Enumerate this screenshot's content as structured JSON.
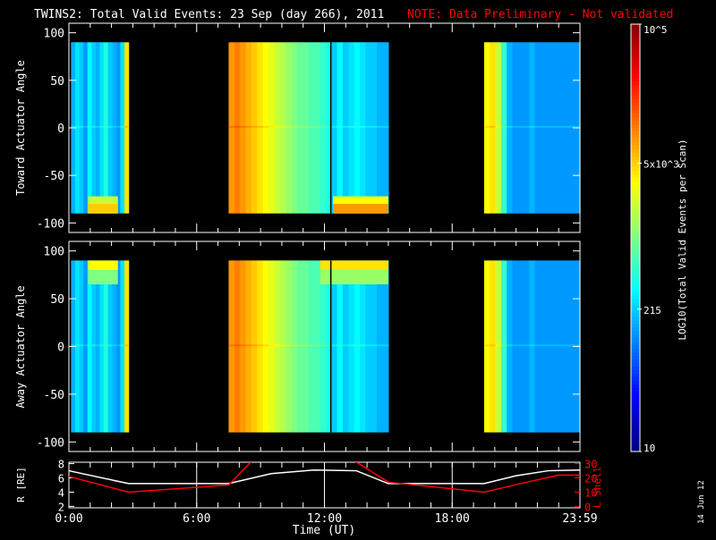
{
  "title": {
    "main": "TWINS2: Total Valid Events: 23 Sep (day 266), 2011",
    "note": "NOTE: Data Preliminary - Not validated"
  },
  "stamp": "14 Jun 12",
  "colors": {
    "note": "#ff0000",
    "r_line": "#ffffff",
    "l_line": "#ff0000"
  },
  "chart_data": [
    {
      "type": "heatmap",
      "name": "toward",
      "ylabel": "Toward Actuator Angle",
      "ylim": [
        -110,
        110
      ],
      "yticks": [
        100,
        50,
        0,
        -50,
        -100
      ],
      "ytick_labels": [
        "100",
        "50",
        "0",
        "-50",
        "-100"
      ],
      "data_yrange": [
        -90,
        90
      ],
      "xlim_hours": [
        0,
        24
      ],
      "blocks": [
        {
          "start": 0.1,
          "end": 2.8,
          "cols": [
            2.2,
            2.4,
            2.3,
            2.1,
            2.5,
            2.3,
            2.2,
            2.4,
            2.6,
            2.3,
            2.2,
            2.1,
            2.4,
            3.6
          ],
          "low_enh": [
            [
              0.9,
              2.3,
              3.7
            ]
          ]
        },
        {
          "start": 7.5,
          "end": 15.0,
          "cols": [
            3.9,
            4.0,
            3.9,
            3.8,
            3.7,
            3.6,
            3.5,
            3.4,
            3.3,
            3.2,
            3.1,
            3.0,
            2.9,
            2.9,
            2.8,
            2.8,
            2.7,
            2.6,
            2.3,
            2.5,
            2.3,
            2.4,
            2.5,
            2.4,
            2.3,
            2.3,
            2.2,
            2.2
          ],
          "low_enh": [
            [
              12.4,
              15.0,
              3.9
            ]
          ]
        },
        {
          "start": 19.5,
          "end": 24.0,
          "cols": [
            3.5,
            3.6,
            3.3,
            2.7,
            2.2,
            2.1,
            2.1,
            2.1,
            2.2,
            2.1,
            2.1,
            2.1,
            2.1,
            2.1,
            2.1,
            2.1,
            2.1
          ],
          "low_enh": []
        }
      ],
      "marker_hour": 12.3
    },
    {
      "type": "heatmap",
      "name": "away",
      "ylabel": "Away Actuator Angle",
      "ylim": [
        -110,
        110
      ],
      "yticks": [
        100,
        50,
        0,
        -50,
        -100
      ],
      "ytick_labels": [
        "100",
        "50",
        "0",
        "-50",
        "-100"
      ],
      "data_yrange": [
        -90,
        90
      ],
      "xlim_hours": [
        0,
        24
      ],
      "blocks": [
        {
          "start": 0.1,
          "end": 2.8,
          "cols": [
            2.2,
            2.4,
            2.3,
            2.1,
            2.5,
            2.3,
            2.2,
            2.4,
            2.6,
            2.3,
            2.2,
            2.1,
            2.4,
            3.6
          ],
          "high_enh": [
            [
              0.9,
              2.3,
              3.5
            ]
          ]
        },
        {
          "start": 7.5,
          "end": 15.0,
          "cols": [
            3.9,
            4.0,
            3.9,
            3.8,
            3.7,
            3.6,
            3.5,
            3.4,
            3.3,
            3.2,
            3.1,
            3.0,
            2.9,
            2.9,
            2.8,
            2.8,
            2.7,
            2.6,
            2.3,
            2.5,
            2.3,
            2.4,
            2.5,
            2.4,
            2.3,
            2.3,
            2.2,
            2.2
          ],
          "high_enh": [
            [
              11.8,
              15.0,
              3.6
            ]
          ]
        },
        {
          "start": 19.5,
          "end": 24.0,
          "cols": [
            3.5,
            3.6,
            3.3,
            2.7,
            2.2,
            2.1,
            2.1,
            2.1,
            2.2,
            2.1,
            2.1,
            2.1,
            2.1,
            2.1,
            2.1,
            2.1,
            2.1
          ],
          "high_enh": []
        }
      ],
      "marker_hour": 12.3
    },
    {
      "type": "line",
      "name": "orbit",
      "ylabel": "R [RE]",
      "ylabel_right": "L Shell",
      "ylim": [
        2,
        8
      ],
      "yticks_left": [
        "8",
        "6",
        "4",
        "2"
      ],
      "ylim_right": [
        0,
        30
      ],
      "yticks_right": [
        "30",
        "20",
        "10",
        "0"
      ],
      "xlabel": "Time (UT)",
      "xtick_labels": [
        "0:00",
        "6:00",
        "12:00",
        "18:00",
        "23:59"
      ],
      "xtick_hours": [
        0,
        6,
        12,
        18,
        24
      ],
      "series": [
        {
          "name": "R",
          "x": [
            0,
            2.8,
            7.5,
            9.5,
            11.5,
            13.5,
            15,
            19.5,
            21,
            22.5,
            24
          ],
          "y": [
            7,
            5.2,
            5.2,
            6.6,
            7.1,
            7.0,
            5.2,
            5.2,
            6.3,
            7.0,
            7.1
          ]
        },
        {
          "name": "L Shell",
          "segments": [
            {
              "x": [
                0,
                2.8,
                7.5,
                8.6
              ],
              "y": [
                21,
                10,
                15,
                32
              ]
            },
            {
              "x": [
                13.4,
                15,
                19.5,
                21.5,
                23,
                24
              ],
              "y": [
                32,
                17,
                10,
                17,
                22,
                22
              ]
            }
          ]
        }
      ]
    },
    {
      "type": "colorbar",
      "label": "LOG10(Total Valid Events per Scan)",
      "range_log10": [
        1,
        5
      ],
      "tick_labels": [
        "10^5",
        "5x10^3",
        "215",
        "10"
      ],
      "tick_values": [
        100000,
        5000,
        215,
        10
      ]
    }
  ]
}
